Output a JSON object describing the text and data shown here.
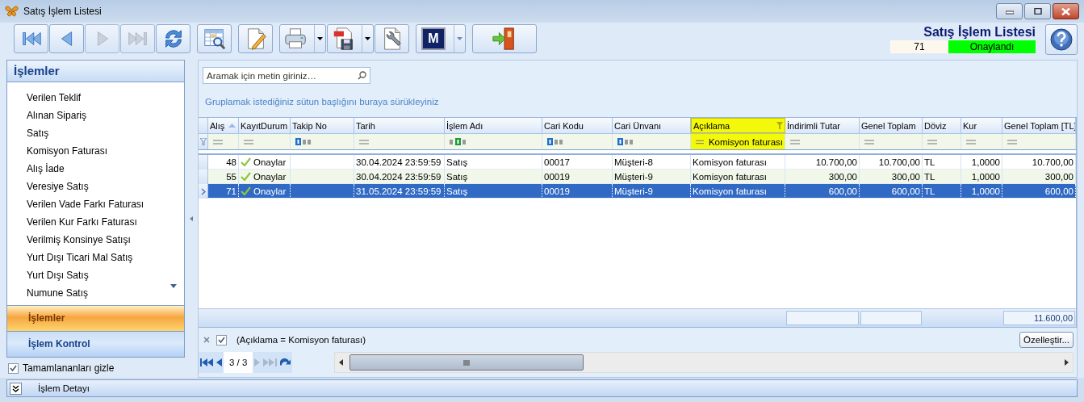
{
  "window": {
    "title": "Satış İşlem Listesi"
  },
  "toolbar": {
    "groups": [
      {
        "buttons": [
          {
            "kind": "first",
            "disabled": false
          },
          {
            "kind": "prev",
            "disabled": false
          },
          {
            "kind": "next",
            "disabled": true
          },
          {
            "kind": "last",
            "disabled": true
          },
          {
            "kind": "refresh",
            "disabled": false
          }
        ]
      },
      {
        "buttons": [
          {
            "kind": "grid-search",
            "disabled": false
          }
        ]
      },
      {
        "buttons": [
          {
            "kind": "edit",
            "disabled": false
          }
        ]
      },
      {
        "buttons": [
          {
            "kind": "print",
            "disabled": false,
            "dropdown": true
          },
          {
            "kind": "pdf",
            "disabled": false,
            "dropdown": true
          },
          {
            "kind": "settings-doc",
            "disabled": false
          }
        ]
      },
      {
        "buttons": [
          {
            "kind": "letter",
            "label": "M",
            "disabled": false,
            "dropdown": true
          }
        ]
      },
      {
        "buttons": [
          {
            "kind": "exit",
            "disabled": false
          }
        ]
      }
    ],
    "heading": "Satış İşlem Listesi",
    "record_no": "71",
    "status": {
      "text": "Onaylandı",
      "color": "#00ff00"
    }
  },
  "sidebar": {
    "title": "İşlemler",
    "items": [
      {
        "label": "Verilen Teklif",
        "selected": false
      },
      {
        "label": "Alınan Sipariş",
        "selected": false
      },
      {
        "label": "Satış",
        "selected": false
      },
      {
        "label": "Komisyon Faturası",
        "selected": false
      },
      {
        "label": "Alış İade",
        "selected": false
      },
      {
        "label": "Veresiye Satış",
        "selected": false
      },
      {
        "label": "Verilen Vade Farkı Faturası",
        "selected": false
      },
      {
        "label": "Verilen Kur Farkı Faturası",
        "selected": false
      },
      {
        "label": "Verilmiş Konsinye Satışı",
        "selected": false
      },
      {
        "label": "Yurt Dışı Ticari Mal Satış",
        "selected": false
      },
      {
        "label": "Yurt Dışı Satış",
        "selected": false
      },
      {
        "label": "Numune Satış",
        "selected": false
      }
    ],
    "groups": [
      {
        "label": "İşlemler",
        "selected": true
      },
      {
        "label": "İşlem Kontrol",
        "selected": false
      }
    ],
    "hide_completed": {
      "label": "Tamamlananları gizle",
      "checked": true
    }
  },
  "grid": {
    "search": {
      "placeholder": "Aramak için metin giriniz…"
    },
    "group_panel": "Gruplamak istediğiniz sütun başlığını buraya sürükleyiniz",
    "columns": [
      {
        "title": "Alış",
        "sorted": true,
        "filtered": false,
        "filter": {
          "kind": "equals"
        },
        "numeric": true
      },
      {
        "title": "KayıtDurum",
        "filtered": false,
        "filter": {
          "kind": "equals"
        }
      },
      {
        "title": "Takip No",
        "filtered": false,
        "filter": {
          "kind": "text"
        }
      },
      {
        "title": "Tarih",
        "filtered": false,
        "filter": {
          "kind": "equals"
        }
      },
      {
        "title": "İşlem Adı",
        "filtered": false,
        "filter": {
          "kind": "textalt"
        }
      },
      {
        "title": "Cari Kodu",
        "filtered": false,
        "filter": {
          "kind": "text"
        }
      },
      {
        "title": "Cari Ünvanı",
        "filtered": false,
        "filter": {
          "kind": "text"
        }
      },
      {
        "title": "Açıklama",
        "filtered": true,
        "filter": {
          "kind": "equals",
          "value": "Komisyon faturası"
        }
      },
      {
        "title": "İndirimli Tutar",
        "filtered": false,
        "filter": {
          "kind": "equals"
        },
        "numeric": true,
        "summary_box": true
      },
      {
        "title": "Genel Toplam",
        "filtered": false,
        "filter": {
          "kind": "equals"
        },
        "numeric": true,
        "summary_box": true
      },
      {
        "title": "Döviz",
        "filtered": false,
        "filter": {
          "kind": "equals"
        }
      },
      {
        "title": "Kur",
        "filtered": false,
        "filter": {
          "kind": "equals"
        },
        "numeric": true
      },
      {
        "title": "Genel Toplam [TL]",
        "filtered": false,
        "filter": {
          "kind": "equals"
        },
        "numeric": true,
        "summary": "11.600,00"
      }
    ],
    "rows": [
      {
        "selected": false,
        "approved": true,
        "cells": [
          "48",
          "Onaylar",
          null,
          "30.04.2024 23:59:59",
          "Satış",
          "00017",
          "Müşteri-8",
          "Komisyon faturası",
          "10.700,00",
          "10.700,00",
          "TL",
          "1,0000",
          "10.700,00"
        ]
      },
      {
        "selected": false,
        "approved": true,
        "cells": [
          "55",
          "Onaylar",
          null,
          "30.04.2024 23:59:59",
          "Satış",
          "00019",
          "Müşteri-9",
          "Komisyon faturası",
          "300,00",
          "300,00",
          "TL",
          "1,0000",
          "300,00"
        ]
      },
      {
        "selected": true,
        "approved": true,
        "cells": [
          "71",
          "Onaylar",
          null,
          "31.05.2024 23:59:59",
          "Satış",
          "00019",
          "Müşteri-9",
          "Komisyon faturası",
          "600,00",
          "600,00",
          "TL",
          "1,0000",
          "600,00"
        ]
      }
    ],
    "filter": {
      "text": "(Açıklama = Komisyon faturası)",
      "checked": true
    },
    "customize_button": "Özelleştir...",
    "navigator": {
      "position": "3 / 3",
      "buttons": [
        {
          "kind": "first",
          "disabled": false
        },
        {
          "kind": "prev",
          "disabled": false
        },
        {
          "kind": "next",
          "disabled": true
        },
        {
          "kind": "last",
          "disabled": true
        },
        {
          "kind": "redo",
          "disabled": false
        }
      ]
    }
  },
  "bottom_bar": {
    "label": "İşlem Detayı",
    "expanded": false
  }
}
